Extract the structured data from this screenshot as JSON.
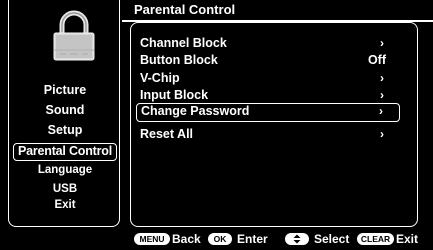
{
  "header": {
    "title": "Parental Control"
  },
  "sidebar": {
    "lock_icon": "padlock-icon",
    "items": [
      {
        "label": "Picture"
      },
      {
        "label": "Sound"
      },
      {
        "label": "Setup"
      },
      {
        "label": "Parental Control",
        "selected": true
      },
      {
        "label": "Language"
      },
      {
        "label": "USB"
      },
      {
        "label": "Exit"
      }
    ]
  },
  "menu": {
    "items": [
      {
        "label": "Channel Block",
        "value": "›"
      },
      {
        "label": "Button Block",
        "value": "Off"
      },
      {
        "label": "V-Chip",
        "value": "›"
      },
      {
        "label": "Input Block",
        "value": "›"
      },
      {
        "label": "Change Password",
        "value": "›",
        "selected": true
      },
      {
        "label": "Reset All",
        "value": "›"
      }
    ]
  },
  "footer": {
    "menu_key": "MENU",
    "back_label": "Back",
    "ok_key": "OK",
    "enter_label": "Enter",
    "select_label": "Select",
    "clear_key": "CLEAR",
    "exit_label": "Exit"
  },
  "colors": {
    "background": "#000000",
    "foreground": "#ffffff"
  }
}
